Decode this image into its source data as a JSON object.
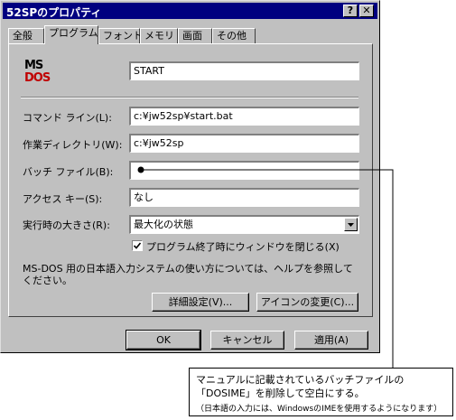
{
  "window": {
    "title": "52SPのプロパティ",
    "help_button": "?",
    "close_button": "✕"
  },
  "tabs": [
    {
      "label": "全般"
    },
    {
      "label": "プログラム"
    },
    {
      "label": "フォント"
    },
    {
      "label": "メモリ"
    },
    {
      "label": "画面"
    },
    {
      "label": "その他"
    }
  ],
  "program": {
    "icon_text_top": "MS",
    "icon_text_bottom": "DOS",
    "name_value": "START",
    "command_line_label": "コマンド ライン(L):",
    "command_line_value": "c:¥jw52sp¥start.bat",
    "working_dir_label": "作業ディレクトリ(W):",
    "working_dir_value": "c:¥jw52sp",
    "batch_file_label": "バッチ ファイル(B):",
    "batch_file_value": "",
    "shortcut_key_label": "アクセス キー(S):",
    "shortcut_key_value": "なし",
    "run_label": "実行時の大きさ(R):",
    "run_value": "最大化の状態",
    "close_on_exit_label": "プログラム終了時にウィンドウを閉じる(X)",
    "close_on_exit_checked": true,
    "help_text": "MS-DOS 用の日本語入力システムの使い方については、ヘルプを参照してください。",
    "advanced_button": "詳細設定(V)...",
    "change_icon_button": "アイコンの変更(C)..."
  },
  "footer": {
    "ok_button": "OK",
    "cancel_button": "キャンセル",
    "apply_button": "適用(A)"
  },
  "annotation": {
    "line1": "マニュアルに記載されているバッチファイルの",
    "line2": "「DOSIME」を削除して空白にする。",
    "line3": "（日本語の入力には、WindowsのIMEを使用するようになります）"
  }
}
